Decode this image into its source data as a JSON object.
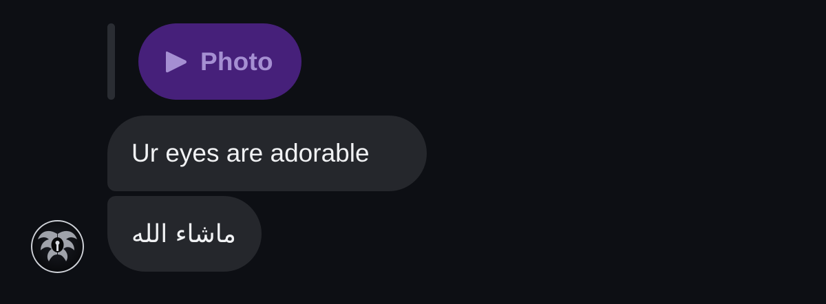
{
  "colors": {
    "background": "#0d0f14",
    "bubble": "#25272c",
    "bubble_text": "#f1f2f4",
    "photo_chip": "#46207a",
    "photo_label": "#a58fd2",
    "reply_bar": "#2a2d33"
  },
  "reply_preview": {
    "icon": "play-icon",
    "label": "Photo"
  },
  "messages": [
    {
      "text": "Ur eyes are adorable"
    },
    {
      "text": "ماشاء الله"
    }
  ],
  "sender": {
    "avatar_icon": "winged-emblem-avatar"
  }
}
